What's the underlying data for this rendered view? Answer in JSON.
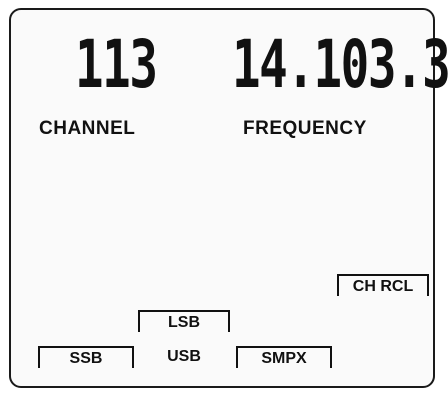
{
  "display": {
    "channel_digits": "113",
    "frequency_digits": "14.103.3",
    "channel_label": "CHANNEL",
    "frequency_label": "FREQUENCY"
  },
  "modes": {
    "ch_rcl": "CH RCL",
    "lsb": "LSB",
    "ssb": "SSB",
    "usb": "USB",
    "smpx": "SMPX"
  }
}
